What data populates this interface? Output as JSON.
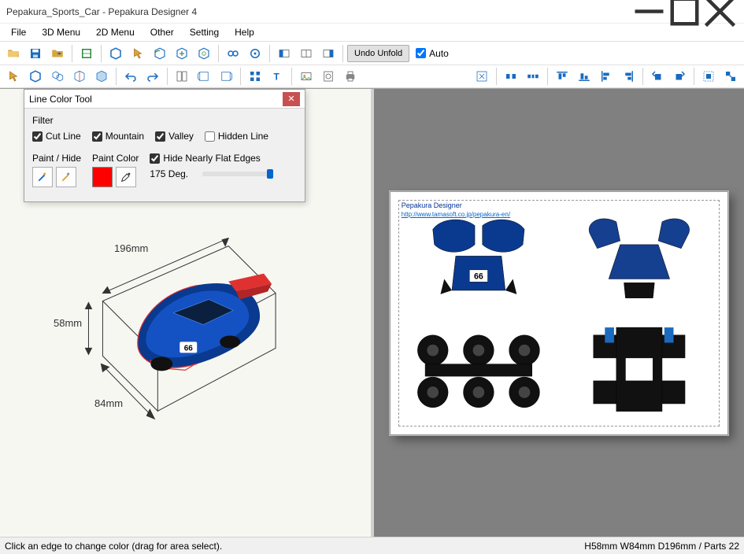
{
  "title": "Pepakura_Sports_Car - Pepakura Designer 4",
  "menu": [
    "File",
    "3D Menu",
    "2D Menu",
    "Other",
    "Setting",
    "Help"
  ],
  "toolbar1": {
    "undo_unfold": "Undo Unfold",
    "auto_label": "Auto"
  },
  "dialog": {
    "title": "Line Color Tool",
    "filter_label": "Filter",
    "cut_line": "Cut Line",
    "mountain": "Mountain",
    "valley": "Valley",
    "hidden_line": "Hidden Line",
    "paint_hide": "Paint / Hide",
    "paint_color": "Paint Color",
    "hide_flat": "Hide Nearly Flat Edges",
    "degrees": "175 Deg.",
    "swatch_color": "#ff0000"
  },
  "model_dims": {
    "length": "196mm",
    "height": "58mm",
    "width": "84mm"
  },
  "paper": {
    "app_label": "Pepakura Designer",
    "url": "http://www.tamasoft.co.jp/pepakura-en/"
  },
  "status": {
    "left": "Click an edge to change color (drag for area select).",
    "right": "H58mm W84mm D196mm / Parts 22"
  }
}
